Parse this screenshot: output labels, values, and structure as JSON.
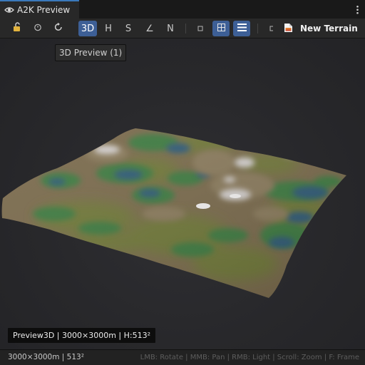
{
  "tab": {
    "title": "A2K Preview",
    "icon": "eye-icon"
  },
  "toolbar": {
    "buttons": [
      {
        "label": "",
        "icon": "lock-open-icon"
      },
      {
        "label": "",
        "icon": "timer-icon"
      },
      {
        "label": "",
        "icon": "refresh-icon"
      },
      {
        "label": "3D",
        "active": true
      },
      {
        "label": "H",
        "active": false
      },
      {
        "label": "S",
        "active": false
      },
      {
        "label": "∠",
        "active": false
      },
      {
        "label": "N",
        "active": false
      },
      {
        "label": "",
        "icon": "square-small-icon",
        "active": false
      },
      {
        "label": "",
        "icon": "grid-icon",
        "active": true
      },
      {
        "label": "",
        "icon": "list-icon",
        "active": true
      },
      {
        "label": "",
        "icon": "bracket-icon",
        "active": false
      }
    ],
    "new_terrain_label": "New Terrain",
    "new_terrain_icon": "terrain-asset-icon"
  },
  "tooltip": {
    "text": "3D Preview (1)"
  },
  "viewport": {
    "overlay_label": "Preview3D | 3000×3000m | H:513²"
  },
  "status": {
    "left": "3000×3000m | 513²",
    "hints": "LMB: Rotate | MMB: Pan | RMB: Light | Scroll: Zoom | F: Frame"
  },
  "colors": {
    "accent_tab": "#3a79bb",
    "active_button": "#3d5f96",
    "terrain_brown": "#7a6e52",
    "terrain_olive": "#6f7a3c",
    "terrain_green": "#3e7a3f",
    "terrain_blue": "#2f5b77"
  }
}
